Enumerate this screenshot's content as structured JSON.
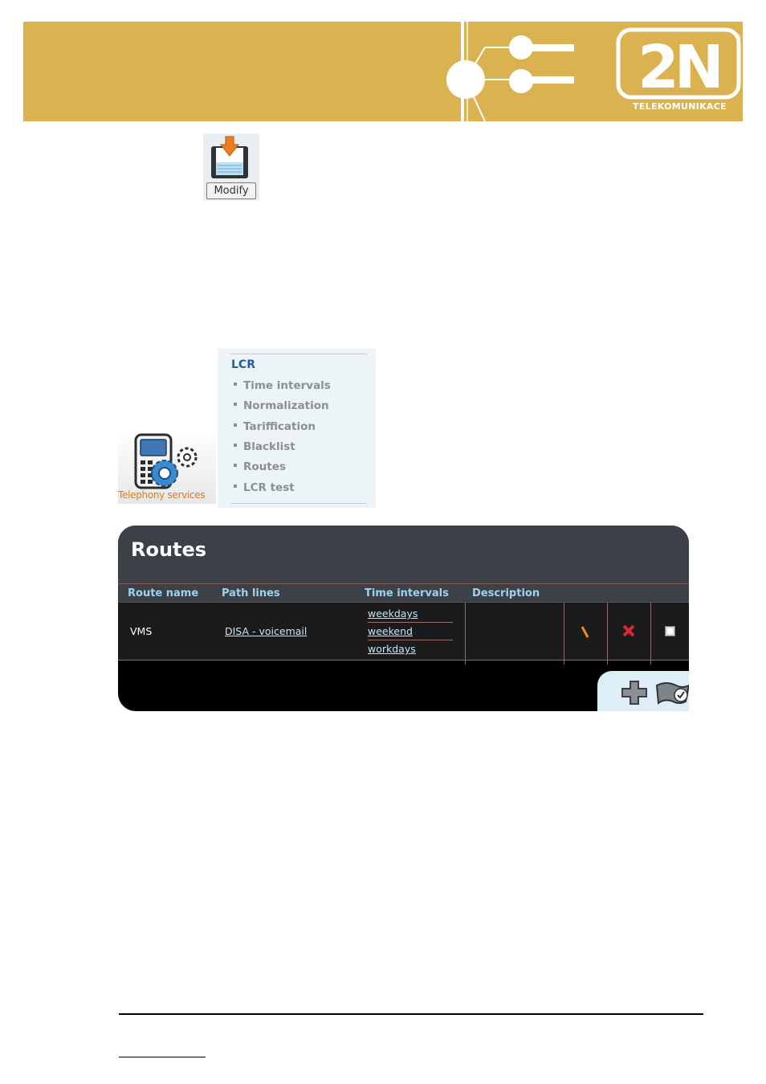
{
  "header": {
    "logo_text": "2N",
    "logo_subtext": "TELEKOMUNIKACE",
    "logo_registered": "®",
    "colors": {
      "banner": "#dab24f",
      "ornament": "#ffffff"
    }
  },
  "modify_button": {
    "label": "Modify",
    "icon": "save-arrow-icon"
  },
  "telephony_services": {
    "label": "Telephony services",
    "icon": "phone-gears-icon",
    "label_color": "#e0791f"
  },
  "lcr_menu": {
    "title": "LCR",
    "items": [
      {
        "label": "Time intervals"
      },
      {
        "label": "Normalization"
      },
      {
        "label": "Tariffication"
      },
      {
        "label": "Blacklist"
      },
      {
        "label": "Routes"
      },
      {
        "label": "LCR test"
      }
    ],
    "title_color": "#1f5f9c"
  },
  "routes_table": {
    "title": "Routes",
    "columns": [
      "Route name",
      "Path lines",
      "Time intervals",
      "Description"
    ],
    "rows": [
      {
        "route_name": "VMS",
        "path_lines": "DISA - voicemail",
        "time_intervals": [
          "weekdays",
          "weekend",
          "workdays"
        ],
        "description": ""
      }
    ],
    "row_actions": [
      "edit-pencil-icon",
      "delete-x-icon",
      "select-checkbox"
    ],
    "footer_actions": [
      "add-plus-icon",
      "apply-flag-icon"
    ],
    "colors": {
      "header": "#3c4147",
      "column_text": "#9fd2ee",
      "link": "#bfe6ff"
    }
  }
}
